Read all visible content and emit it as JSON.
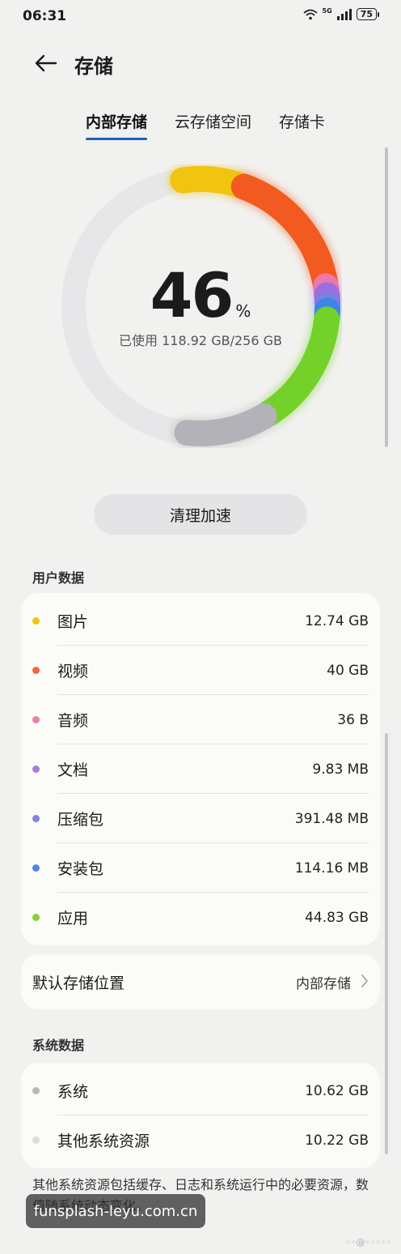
{
  "status": {
    "time": "06:31",
    "network": "5G",
    "battery": "75"
  },
  "header": {
    "title": "存储"
  },
  "tabs": [
    "内部存储",
    "云存储空间",
    "存储卡"
  ],
  "usage": {
    "percent": "46",
    "unit": "%",
    "used_text": "已使用 118.92 GB/256 GB",
    "percent_value": 46
  },
  "ring_colors": {
    "photos": "#f1c40f",
    "videos": "#f25a1f",
    "audio": "#ee77aa",
    "docs": "#9b6fe0",
    "archives": "#7d7de2",
    "apks": "#3e86e6",
    "apps": "#74d12a",
    "system": "#b2b2b8"
  },
  "clean_button": "清理加速",
  "user_data": {
    "label": "用户数据",
    "items": [
      {
        "label": "图片",
        "value": "12.74 GB",
        "color": "#f1c40f"
      },
      {
        "label": "视频",
        "value": "40 GB",
        "color": "#f06a3a"
      },
      {
        "label": "音频",
        "value": "36 B",
        "color": "#ec7fb2"
      },
      {
        "label": "文档",
        "value": "9.83 MB",
        "color": "#a77cde"
      },
      {
        "label": "压缩包",
        "value": "391.48 MB",
        "color": "#8383e0"
      },
      {
        "label": "安装包",
        "value": "114.16 MB",
        "color": "#4c88e8"
      },
      {
        "label": "应用",
        "value": "44.83 GB",
        "color": "#86d12e"
      }
    ]
  },
  "default_storage": {
    "label": "默认存储位置",
    "value": "内部存储"
  },
  "system_data": {
    "label": "系统数据",
    "items": [
      {
        "label": "系统",
        "value": "10.62 GB",
        "color": "#b8b8b8"
      },
      {
        "label": "其他系统资源",
        "value": "10.22 GB",
        "color": "#dcdcdc"
      }
    ]
  },
  "note": "其他系统资源包括缓存、日志和系统运行中的必要资源，数值随系统动态变化。",
  "watermark": "funsplash-leyu.com.cn"
}
